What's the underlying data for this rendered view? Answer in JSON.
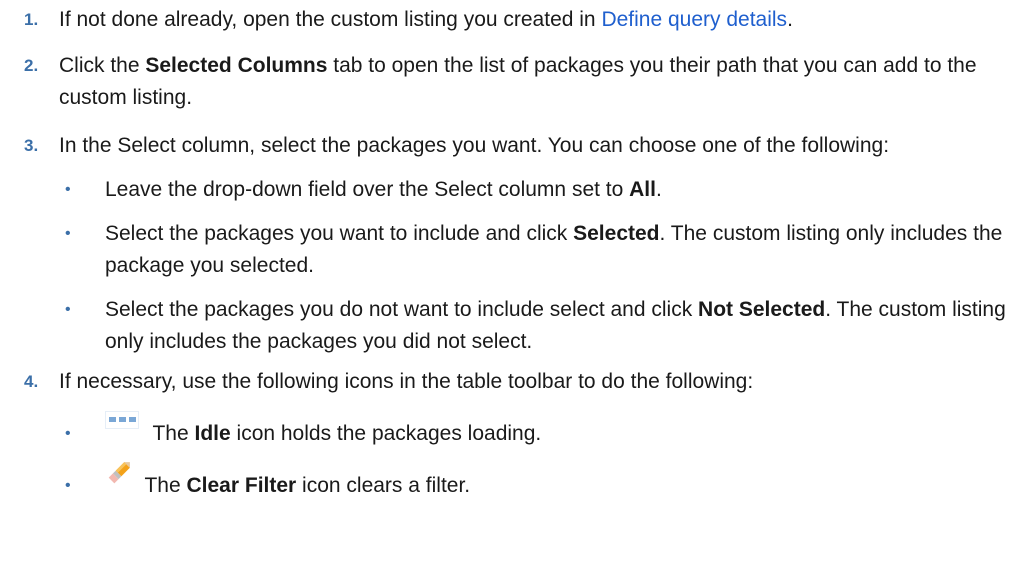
{
  "steps": [
    {
      "num": "1.",
      "pre": "If not done already, open the custom listing you created in ",
      "link": "Define query details",
      "post": "."
    },
    {
      "num": "2.",
      "pre": "Click the ",
      "bold": "Selected Columns",
      "post": " tab to open the list of packages you their path that you can add to the custom listing."
    },
    {
      "num": "3.",
      "text": "In the Select column, select the packages you want. You can choose one of the following:",
      "bullets": [
        {
          "pre": "Leave the drop-down field over the Select column set to ",
          "bold": "All",
          "post": "."
        },
        {
          "pre": "Select the packages you want to include and click ",
          "bold": "Selected",
          "post": ". The custom listing only includes the package you selected."
        },
        {
          "pre": "Select the packages you do not want to include select and click ",
          "bold": "Not Selected",
          "post": ". The custom listing only includes the packages you did not select."
        }
      ]
    },
    {
      "num": "4.",
      "text": "If necessary, use the following icons in the table toolbar to do the following:",
      "bullets": [
        {
          "icon": "idle-icon",
          "pre": "The ",
          "bold": "Idle",
          "post": " icon holds the packages loading."
        },
        {
          "icon": "pencil-eraser-icon",
          "pre": "The ",
          "bold": "Clear Filter",
          "post": " icon clears a filter."
        }
      ]
    }
  ],
  "bullet_char": "•",
  "colors": {
    "number": "#3b6fa8",
    "link": "#1f5fce",
    "text": "#1a1a1a"
  }
}
